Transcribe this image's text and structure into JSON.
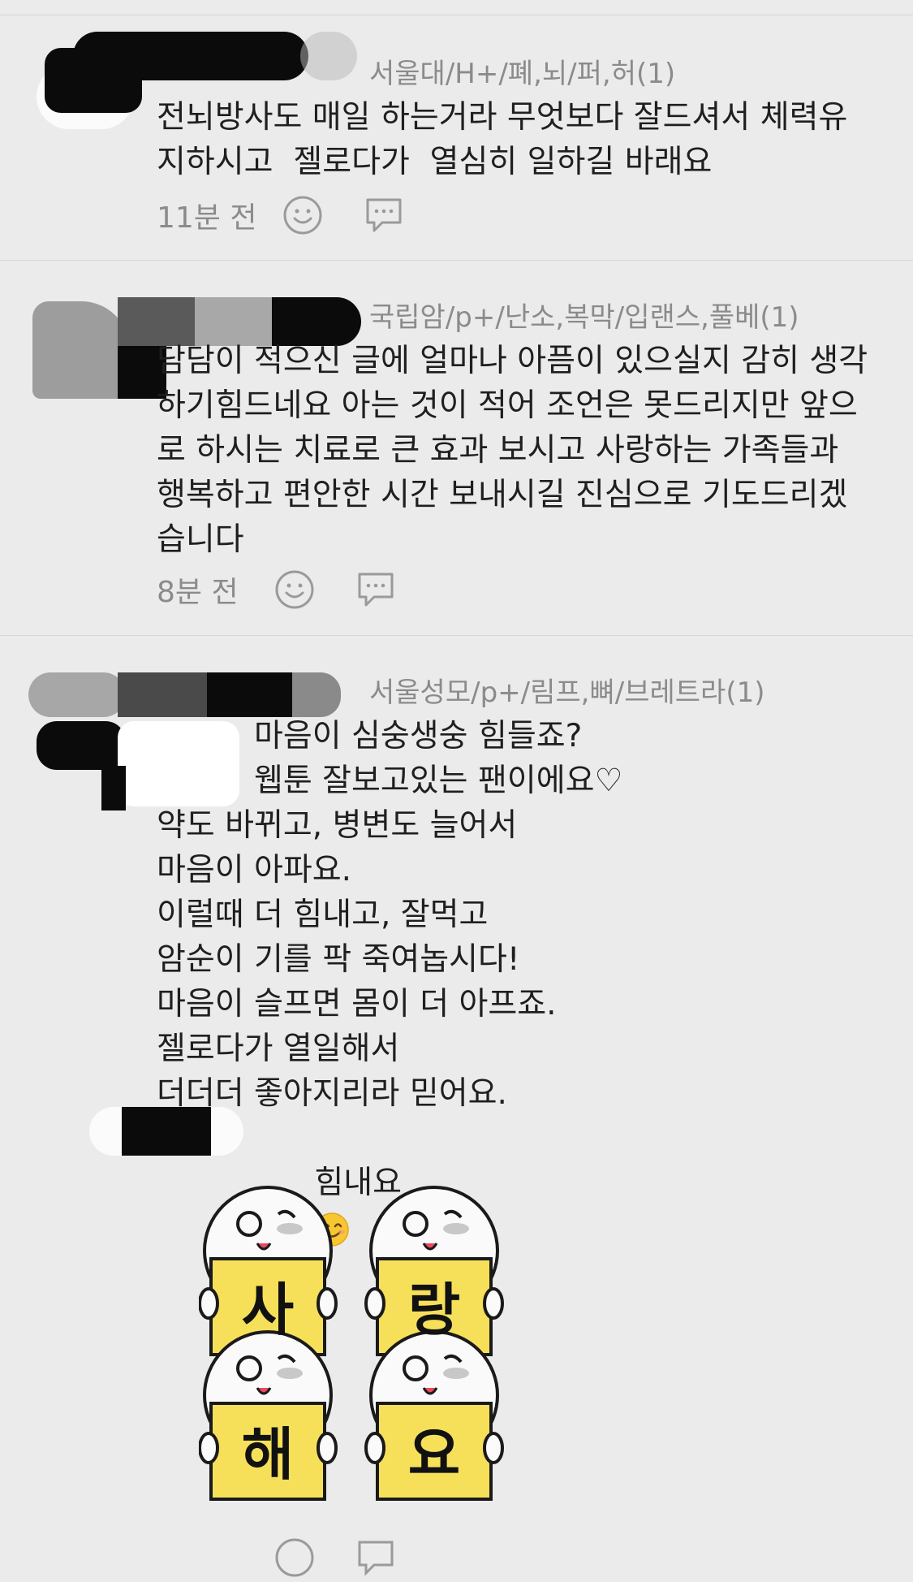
{
  "comments": [
    {
      "author": "서울대/H+/폐,뇌/퍼,허(1)",
      "lines": [
        "전뇌방사도 매일 하는거라 무엇보다 잘드셔서 체력유",
        "지하시고  젤로다가  열심히 일하길 바래요"
      ],
      "time": "11분 전"
    },
    {
      "author": "국립암/p+/난소,복막/입랜스,풀베(1)",
      "lines": [
        "담담이 적으신 글에 얼마나 아픔이 있으실지 감히 생각",
        "하기힘드네요 아는 것이 적어 조언은 못드리지만 앞으",
        "로 하시는 치료로 큰 효과 보시고 사랑하는 가족들과",
        "행복하고 편안한 시간 보내시길 진심으로 기도드리겠",
        "습니다"
      ],
      "time": "8분 전"
    },
    {
      "author": "서울성모/p+/림프,뼈/브레트라(1)",
      "lines_indented": [
        "마음이 심숭생숭 힘들죠?",
        "웹툰 잘보고있는 팬이에요♡"
      ],
      "lines": [
        "약도 바뀌고, 병변도 늘어서",
        "마음이 아파요.",
        "이럴때 더 힘내고, 잘먹고",
        "암순이 기를 팍 죽여놉시다!",
        "마음이 슬프면 몸이 더 아프죠.",
        "젤로다가 열일해서",
        "더더더 좋아지리라 믿어요."
      ],
      "closing": "힘내요",
      "sticker_text": [
        "사",
        "랑",
        "해",
        "요"
      ]
    }
  ],
  "icons": [
    "smile-icon",
    "reply-bubble-icon"
  ],
  "colors": {
    "background": "#ebebeb",
    "text": "#1f1f1f",
    "meta": "#8b8b8b",
    "sticker_yellow": "#f6e05a"
  }
}
